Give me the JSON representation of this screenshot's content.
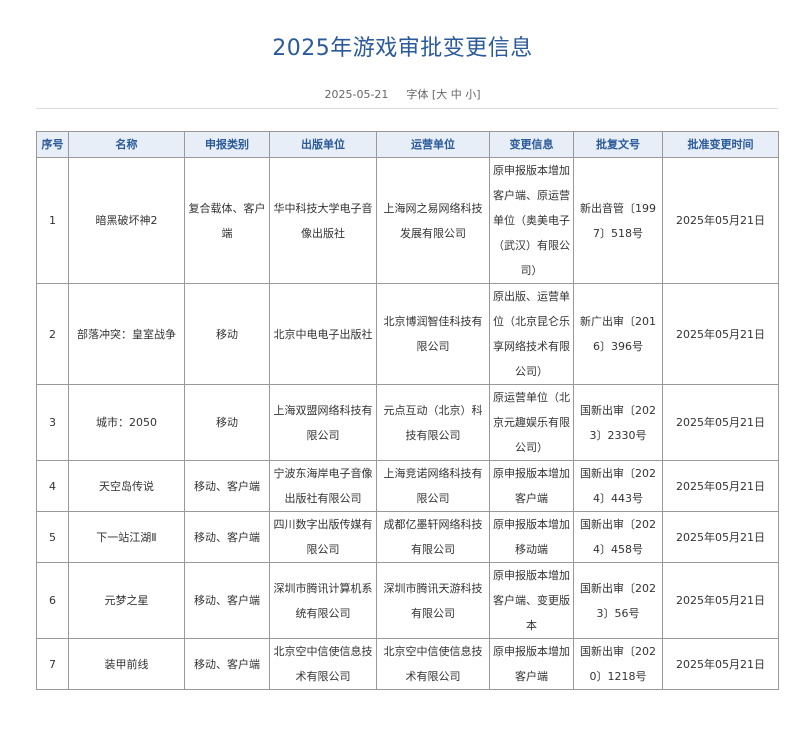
{
  "page": {
    "title": "2025年游戏审批变更信息",
    "date": "2025-05-21",
    "font_label": "字体",
    "font_open": "[",
    "font_large": "大",
    "font_medium": "中",
    "font_small": "小",
    "font_close": "]"
  },
  "table": {
    "headers": [
      "序号",
      "名称",
      "申报类别",
      "出版单位",
      "运营单位",
      "变更信息",
      "批复文号",
      "批准变更时间"
    ],
    "rows": [
      {
        "no": "1",
        "name": "暗黑破坏神2",
        "category": "复合载体、客户端",
        "publisher": "华中科技大学电子音像出版社",
        "operator": "上海网之易网络科技发展有限公司",
        "change": "原申报版本增加客户端、原运营单位（奥美电子（武汉）有限公司）",
        "approval": "新出音管〔1997〕518号",
        "time": "2025年05月21日"
      },
      {
        "no": "2",
        "name": "部落冲突：皇室战争",
        "category": "移动",
        "publisher": "北京中电电子出版社",
        "operator": "北京博润智佳科技有限公司",
        "change": "原出版、运营单位（北京昆仑乐享网络技术有限公司）",
        "approval": "新广出审〔2016〕396号",
        "time": "2025年05月21日"
      },
      {
        "no": "3",
        "name": "城市：2050",
        "category": "移动",
        "publisher": "上海双盟网络科技有限公司",
        "operator": "元点互动（北京）科技有限公司",
        "change": "原运营单位（北京元趣娱乐有限公司）",
        "approval": "国新出审〔2023〕2330号",
        "time": "2025年05月21日"
      },
      {
        "no": "4",
        "name": "天空岛传说",
        "category": "移动、客户端",
        "publisher": "宁波东海岸电子音像出版社有限公司",
        "operator": "上海竞诺网络科技有限公司",
        "change": "原申报版本增加客户端",
        "approval": "国新出审〔2024〕443号",
        "time": "2025年05月21日"
      },
      {
        "no": "5",
        "name": "下一站江湖Ⅱ",
        "category": "移动、客户端",
        "publisher": "四川数字出版传媒有限公司",
        "operator": "成都亿墨轩网络科技有限公司",
        "change": "原申报版本增加移动端",
        "approval": "国新出审〔2024〕458号",
        "time": "2025年05月21日"
      },
      {
        "no": "6",
        "name": "元梦之星",
        "category": "移动、客户端",
        "publisher": "深圳市腾讯计算机系统有限公司",
        "operator": "深圳市腾讯天游科技有限公司",
        "change": "原申报版本增加客户端、变更版本",
        "approval": "国新出审〔2023〕56号",
        "time": "2025年05月21日"
      },
      {
        "no": "7",
        "name": "装甲前线",
        "category": "移动、客户端",
        "publisher": "北京空中信使信息技术有限公司",
        "operator": "北京空中信使信息技术有限公司",
        "change": "原申报版本增加客户端",
        "approval": "国新出审〔2020〕1218号",
        "time": "2025年05月21日"
      }
    ]
  }
}
